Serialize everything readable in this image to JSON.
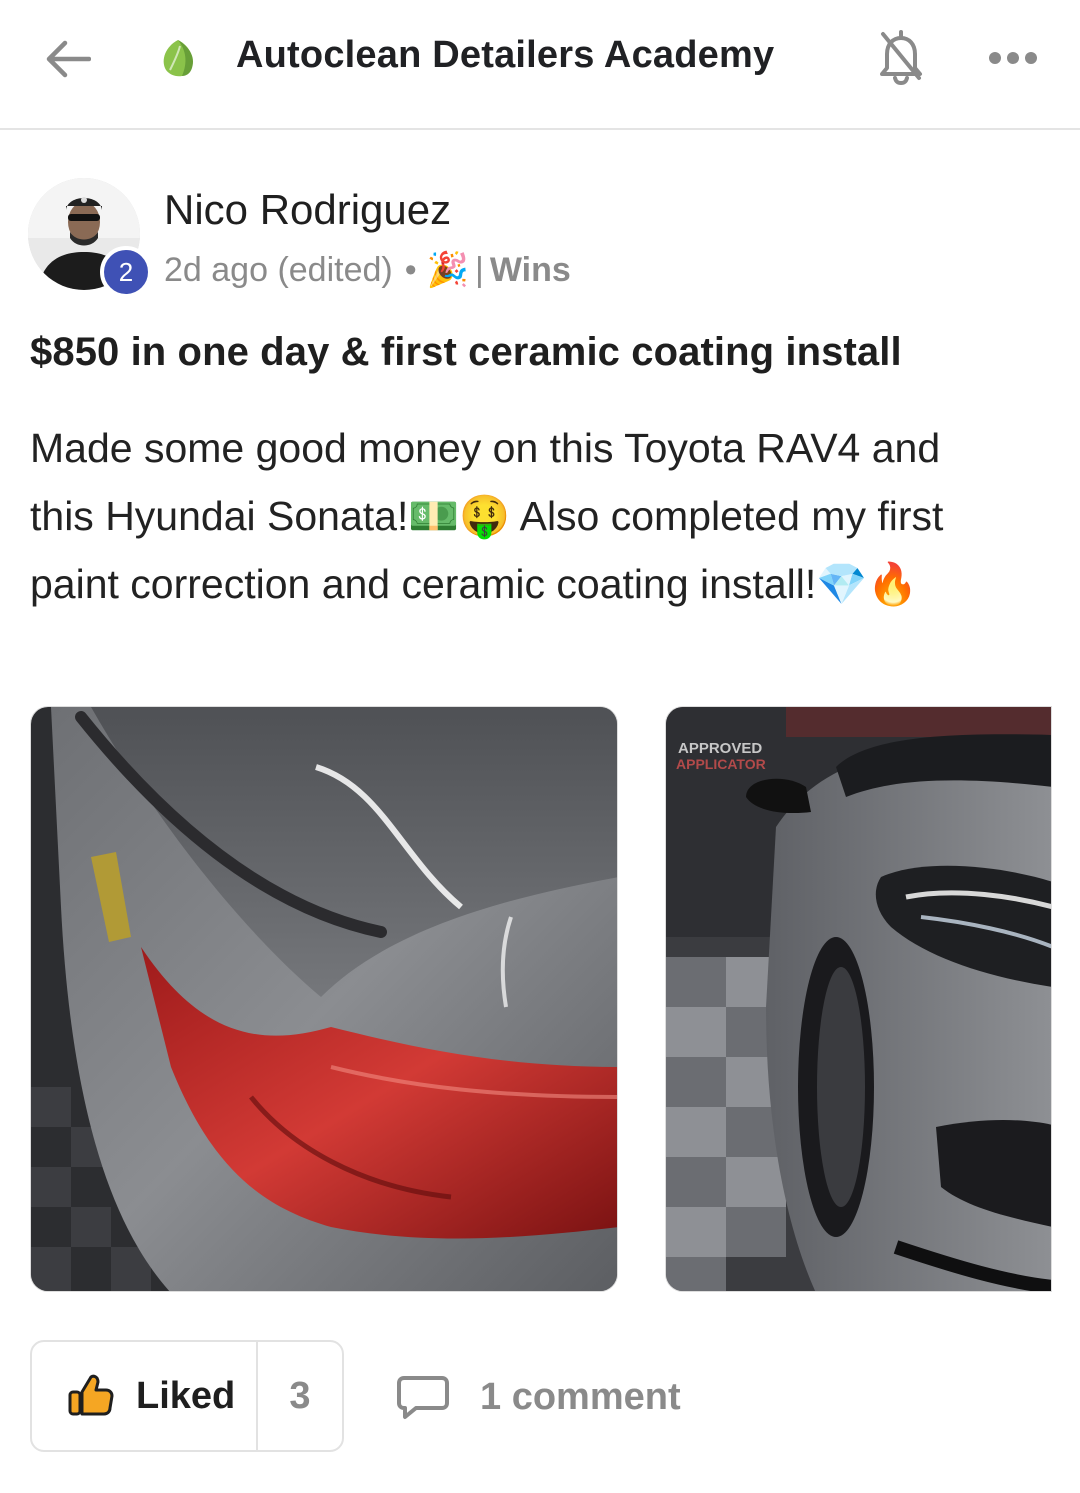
{
  "header": {
    "title": "Autoclean Detailers Academy",
    "back_icon": "back-arrow-icon",
    "logo_icon": "leaf-icon",
    "bell_icon": "bell-icon",
    "more_icon": "more-icon",
    "accent": "#8bc34a"
  },
  "post": {
    "author": "Nico Rodriguez",
    "level": "2",
    "time": "2d ago (edited)",
    "dot": "•",
    "category_emoji": "🎉",
    "pipe": "|",
    "category": "Wins",
    "title": "$850 in one day & first ceramic coating install",
    "body_line1": "Made some good money on this Toyota RAV4 and",
    "body_line2a": "this Hyundai Sonata!",
    "body_emoji1": "💵🤑",
    "body_line2b": " Also completed my first",
    "body_line3": "paint correction and ceramic coating install!",
    "body_emoji2": "💎🔥",
    "image2_sign_line1": "APPROVED",
    "image2_sign_line2": "APPLICATOR"
  },
  "actions": {
    "like_label": "Liked",
    "like_count": "3",
    "comment_label": "1 comment",
    "like_icon": "thumbs-up-icon",
    "comment_icon": "comment-icon",
    "like_color": "#f5a623"
  }
}
